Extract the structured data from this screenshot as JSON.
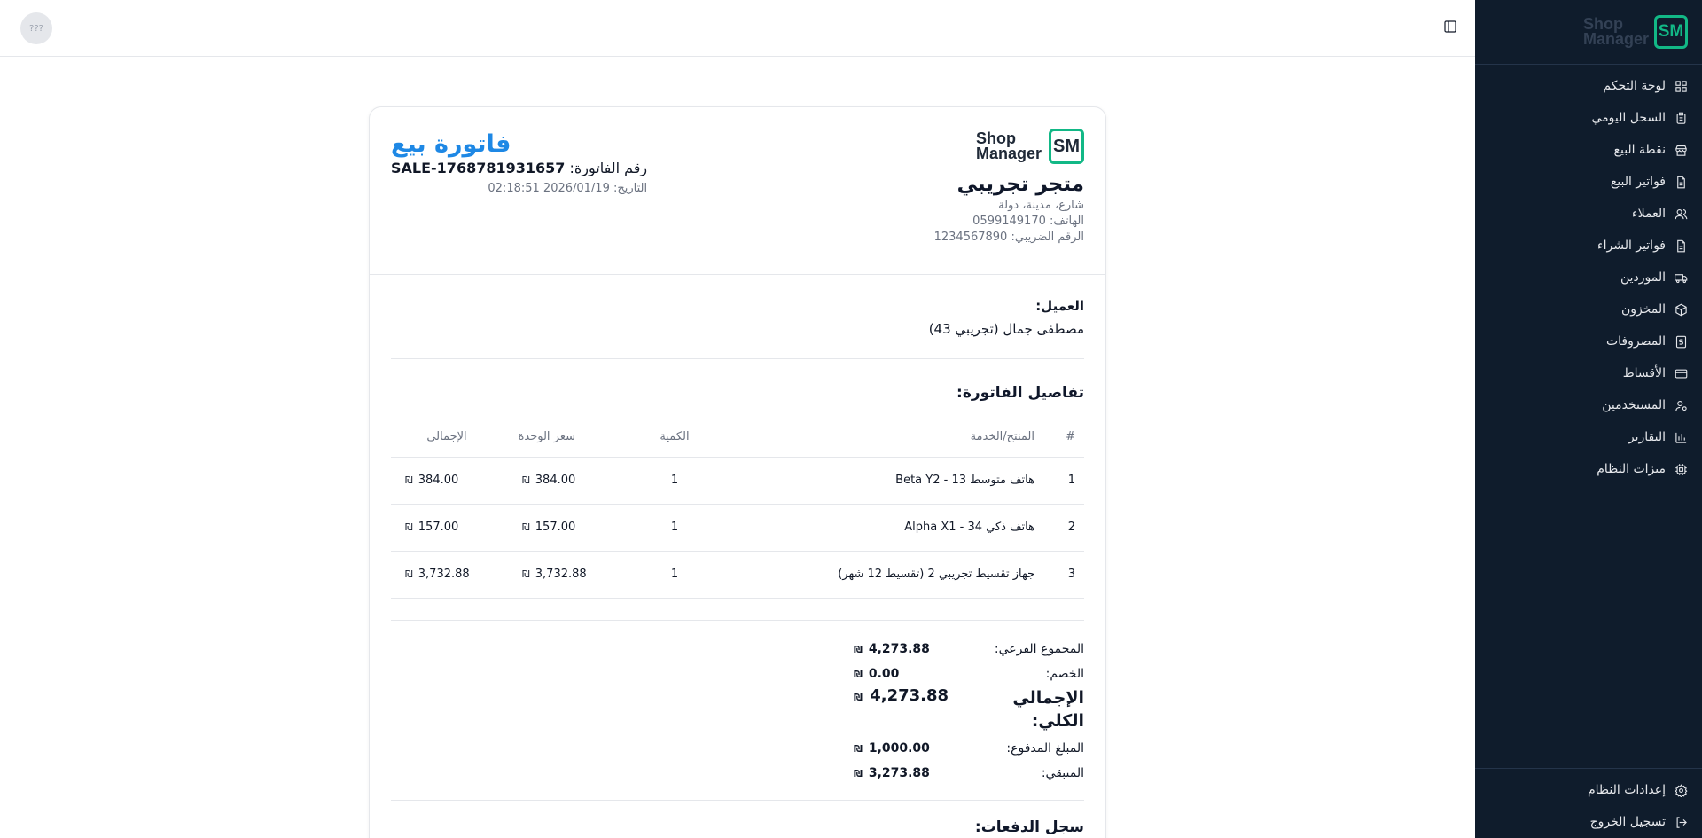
{
  "sidebar": {
    "logo": {
      "mark": "SM",
      "line1": "Shop",
      "line2": "Manager"
    },
    "items": [
      {
        "label": "لوحة التحكم",
        "icon": "dashboard-icon"
      },
      {
        "label": "السجل اليومي",
        "icon": "clipboard-icon"
      },
      {
        "label": "نقطة البيع",
        "icon": "store-icon"
      },
      {
        "label": "فواتير البيع",
        "icon": "file-icon"
      },
      {
        "label": "العملاء",
        "icon": "users-icon"
      },
      {
        "label": "فواتير الشراء",
        "icon": "file-icon"
      },
      {
        "label": "الموردين",
        "icon": "truck-icon"
      },
      {
        "label": "المخزون",
        "icon": "package-icon"
      },
      {
        "label": "المصروفات",
        "icon": "receipt-icon"
      },
      {
        "label": "الأقساط",
        "icon": "credit-card-icon"
      },
      {
        "label": "المستخدمين",
        "icon": "user-cog-icon"
      },
      {
        "label": "التقارير",
        "icon": "bar-chart-icon"
      },
      {
        "label": "ميزات النظام",
        "icon": "chip-icon"
      }
    ],
    "bottom": [
      {
        "label": "إعدادات النظام",
        "icon": "gear-icon"
      },
      {
        "label": "تسجيل الخروج",
        "icon": "logout-icon"
      }
    ]
  },
  "header": {
    "avatar_text": "???"
  },
  "invoice": {
    "title": "فاتورة بيع",
    "number_label": "رقم الفاتورة:",
    "number": "SALE-1768781931657",
    "date_label": "التاريخ:",
    "date": "2026/01/19 02:18:51",
    "store": {
      "logo": {
        "mark": "SM",
        "line1": "Shop",
        "line2": "Manager"
      },
      "name": "متجر تجريبي",
      "address": "شارع، مدينة، دولة",
      "phone_label": "الهاتف:",
      "phone": "0599149170",
      "tax_label": "الرقم الضريبي:",
      "tax": "1234567890"
    },
    "customer_label": "العميل:",
    "customer": "مصطفى جمال (تجريبي 43)",
    "details_title": "تفاصيل الفاتورة:",
    "columns": {
      "num": "#",
      "product": "المنتج/الخدمة",
      "qty": "الكمية",
      "unit": "سعر الوحدة",
      "total": "الإجمالي"
    },
    "currency": "₪",
    "rows": [
      {
        "num": "1",
        "product": "هاتف متوسط 13 - Beta Y2",
        "qty": "1",
        "unit": "384.00",
        "total": "384.00"
      },
      {
        "num": "2",
        "product": "هاتف ذكي 34 - Alpha X1",
        "qty": "1",
        "unit": "157.00",
        "total": "157.00"
      },
      {
        "num": "3",
        "product": "جهاز تقسيط تجريبي 2 (تقسيط 12 شهر)",
        "qty": "1",
        "unit": "3,732.88",
        "total": "3,732.88"
      }
    ],
    "totals": {
      "subtotal_label": "المجموع الفرعي:",
      "subtotal": "4,273.88",
      "discount_label": "الخصم:",
      "discount": "0.00",
      "grand_label": "الإجمالي الكلي:",
      "grand": "4,273.88",
      "paid_label": "المبلغ المدفوع:",
      "paid": "1,000.00",
      "remaining_label": "المتبقي:",
      "remaining": "3,273.88"
    },
    "payments_title": "سجل الدفعات:"
  }
}
